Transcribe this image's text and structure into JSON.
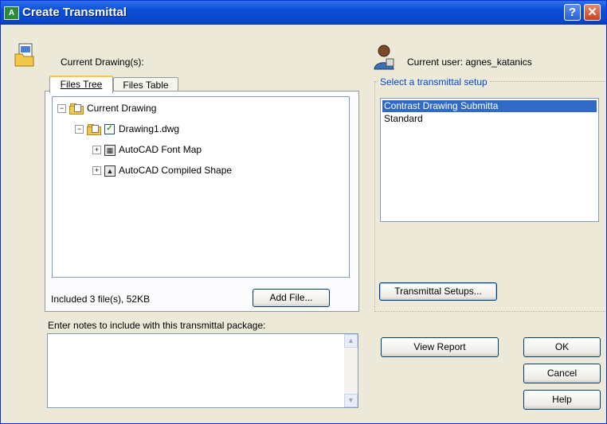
{
  "window": {
    "title": "Create Transmittal",
    "icon_label": "A",
    "help_glyph": "?",
    "close_glyph": "✕"
  },
  "left": {
    "drawings_label": "Current Drawing(s):",
    "tabs": [
      {
        "label": "Files Tree",
        "active": true
      },
      {
        "label": "Files Table",
        "active": false
      }
    ],
    "tree": [
      {
        "label": "Current Drawing",
        "expander": "−",
        "icon": "folder-icon",
        "checked": null
      },
      {
        "label": "Drawing1.dwg",
        "expander": "−",
        "icon": "folder-icon",
        "checked": true
      },
      {
        "label": "AutoCAD Font Map",
        "expander": "+",
        "icon": "font-map-icon",
        "checked": null
      },
      {
        "label": "AutoCAD Compiled Shape",
        "expander": "+",
        "icon": "compiled-shape-icon",
        "checked": null
      }
    ],
    "status": "Included 3 file(s), 52KB",
    "add_file_label": "Add File...",
    "notes_label": "Enter notes to include with this transmittal package:",
    "notes_value": ""
  },
  "right": {
    "user_label": "Current user: agnes_katanics",
    "setup_label": "Select a transmittal setup",
    "setups": [
      {
        "label": "Contrast Drawing Submitta",
        "selected": true
      },
      {
        "label": "Standard",
        "selected": false
      }
    ],
    "setups_button_label": "Transmittal Setups..."
  },
  "buttons": {
    "view_report": "View Report",
    "ok": "OK",
    "cancel": "Cancel",
    "help": "Help"
  },
  "colors": {
    "titlebar": "#0a4fd8",
    "selection": "#316ac5",
    "dialog_bg": "#ece9d8"
  }
}
